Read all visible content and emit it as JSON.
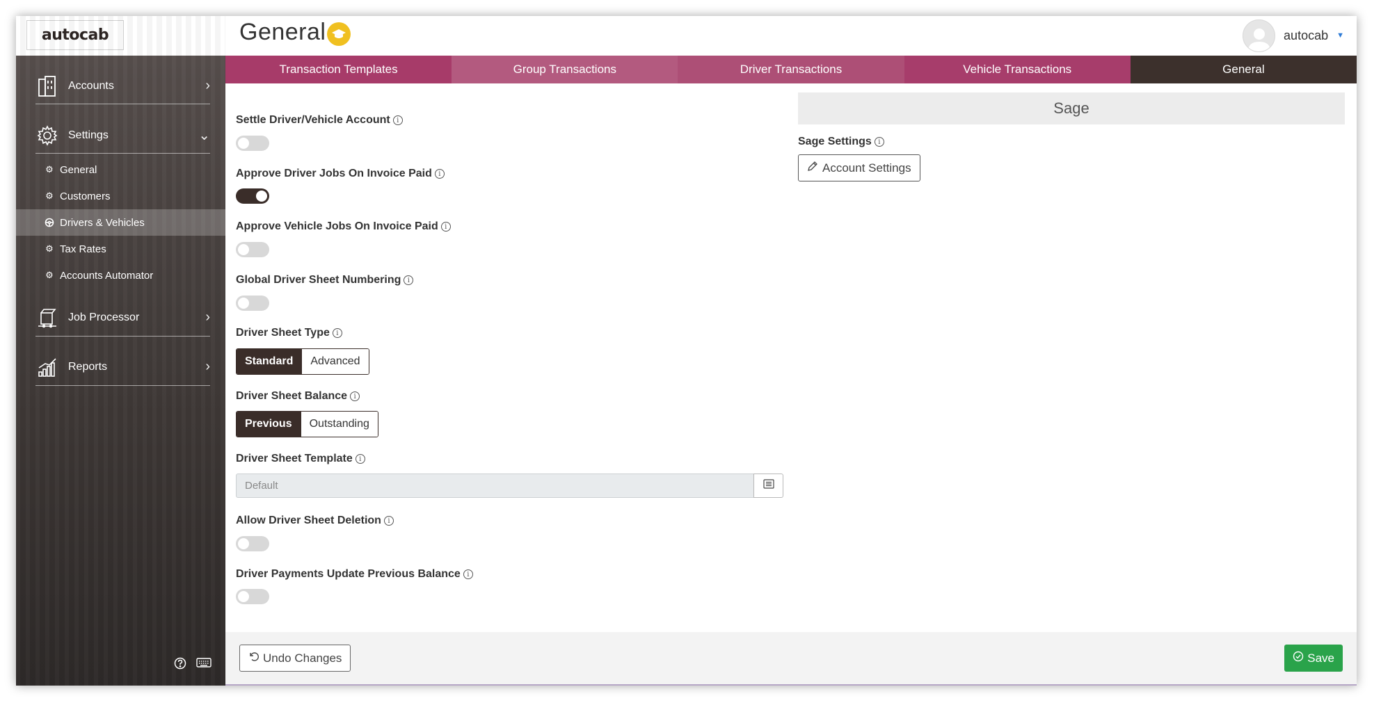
{
  "app": {
    "logo_text": "autocab"
  },
  "header": {
    "title": "General",
    "user_name": "autocab"
  },
  "sidebar": {
    "items": [
      {
        "label": "Accounts",
        "icon": "building-icon"
      },
      {
        "label": "Settings",
        "icon": "gear-icon"
      },
      {
        "label": "Job Processor",
        "icon": "job-processor-icon"
      },
      {
        "label": "Reports",
        "icon": "reports-chart-icon"
      }
    ],
    "settings_sub": [
      {
        "label": "General",
        "icon": "gears-icon",
        "active": false
      },
      {
        "label": "Customers",
        "icon": "gear-icon",
        "active": false
      },
      {
        "label": "Drivers & Vehicles",
        "icon": "steering-wheel-icon",
        "active": true
      },
      {
        "label": "Tax Rates",
        "icon": "gear-icon",
        "active": false
      },
      {
        "label": "Accounts Automator",
        "icon": "gear-icon",
        "active": false
      }
    ]
  },
  "tabs": [
    {
      "label": "Transaction Templates"
    },
    {
      "label": "Group Transactions"
    },
    {
      "label": "Driver Transactions"
    },
    {
      "label": "Vehicle Transactions"
    },
    {
      "label": "General",
      "active": true
    }
  ],
  "settings": {
    "settle": {
      "label": "Settle Driver/Vehicle Account",
      "on": false
    },
    "approve_driver": {
      "label": "Approve Driver Jobs On Invoice Paid",
      "on": true
    },
    "approve_vehicle": {
      "label": "Approve Vehicle Jobs On Invoice Paid",
      "on": false
    },
    "global_numbering": {
      "label": "Global Driver Sheet Numbering",
      "on": false
    },
    "sheet_type": {
      "label": "Driver Sheet Type",
      "options": [
        "Standard",
        "Advanced"
      ],
      "selected": "Standard"
    },
    "sheet_balance": {
      "label": "Driver Sheet Balance",
      "options": [
        "Previous",
        "Outstanding"
      ],
      "selected": "Previous"
    },
    "sheet_template": {
      "label": "Driver Sheet Template",
      "value": "Default"
    },
    "allow_deletion": {
      "label": "Allow Driver Sheet Deletion",
      "on": false
    },
    "payments_update": {
      "label": "Driver Payments Update Previous Balance",
      "on": false
    }
  },
  "sage": {
    "title": "Sage",
    "settings_label": "Sage Settings",
    "account_settings_button": "Account Settings"
  },
  "footer": {
    "undo_label": "Undo Changes",
    "save_label": "Save"
  },
  "colors": {
    "tab_active": "#3c302c",
    "tab_magenta": "#a73b69",
    "save_green": "#2aa34a",
    "toggle_on": "#3a2d29",
    "title_badge": "#f0c020"
  }
}
